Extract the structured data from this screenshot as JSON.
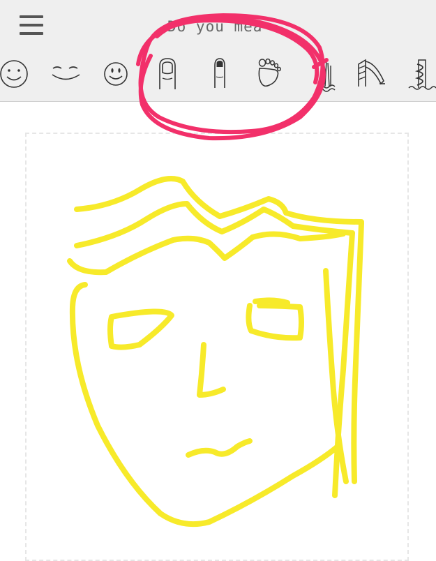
{
  "prompt": {
    "text": "Do you mea"
  },
  "suggestions": [
    {
      "icon": "smiley-face-icon"
    },
    {
      "icon": "closed-eyes-smile-icon"
    },
    {
      "icon": "smiling-face-icon"
    },
    {
      "icon": "thumb-icon"
    },
    {
      "icon": "finger-icon"
    },
    {
      "icon": "foot-icon"
    },
    {
      "icon": "waterfall-icon"
    },
    {
      "icon": "water-slide-icon"
    },
    {
      "icon": "water-park-icon"
    }
  ],
  "colors": {
    "topbar": "#efefef",
    "ink": "#f7ea2a",
    "annotation": "#f2306a",
    "icon": "#333333"
  }
}
